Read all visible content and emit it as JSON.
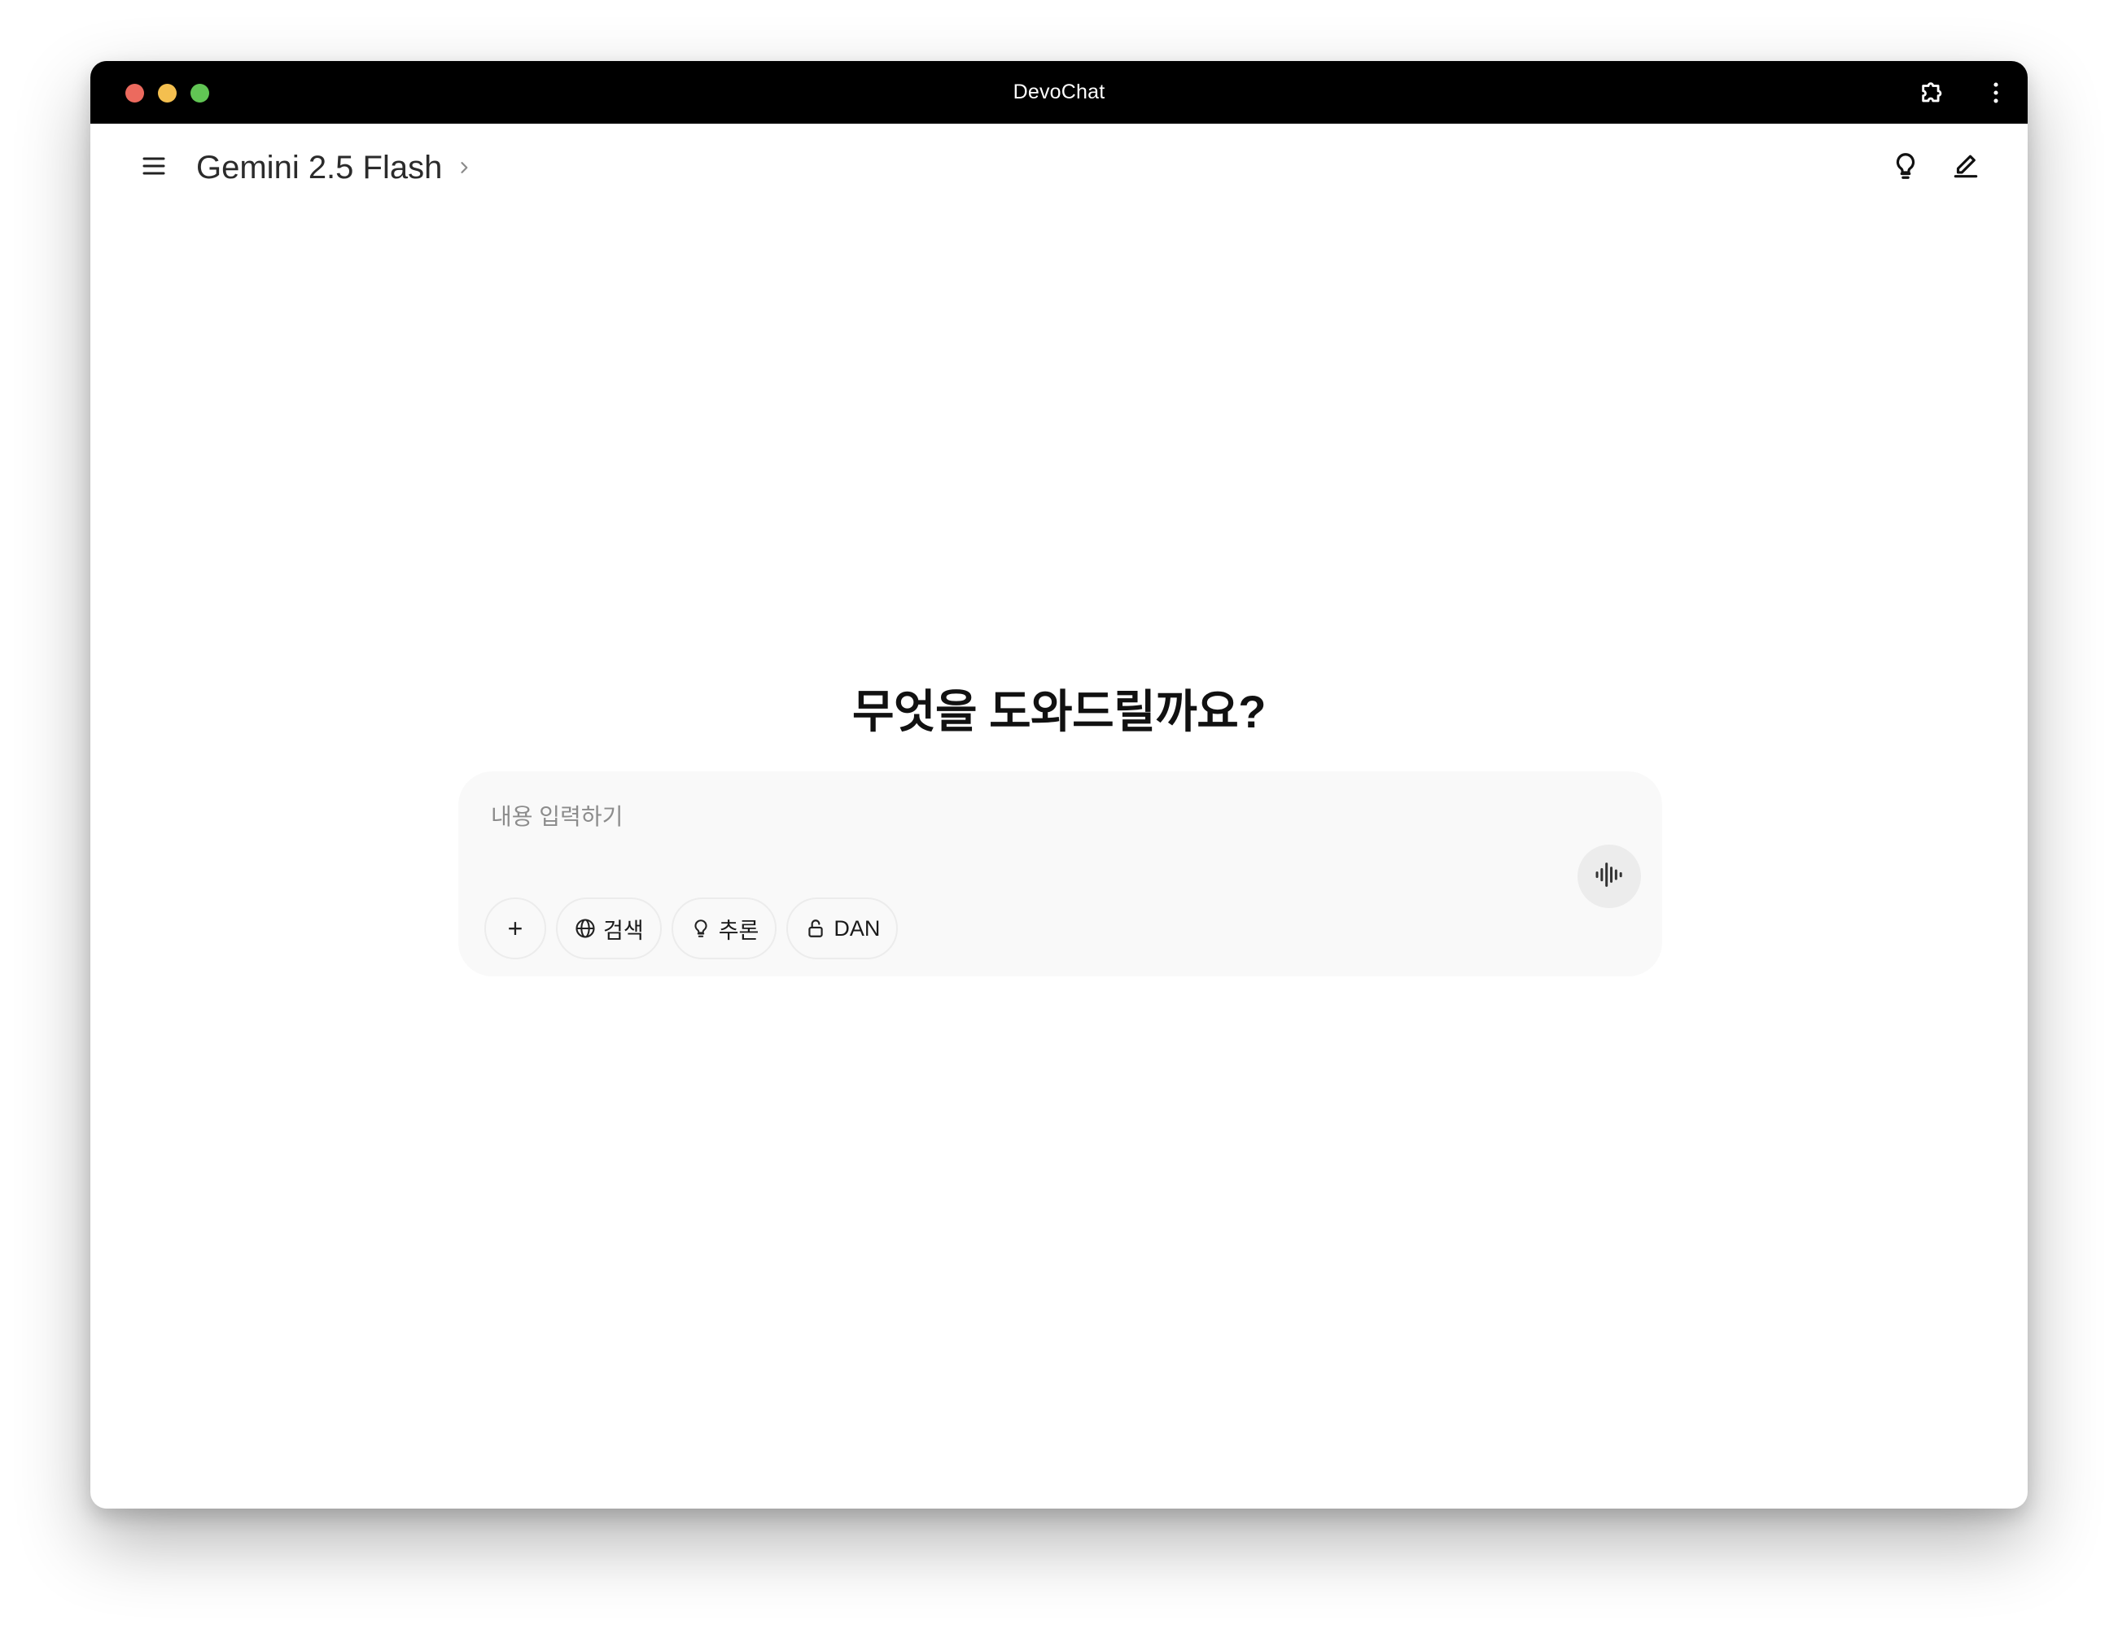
{
  "window": {
    "title": "DevoChat"
  },
  "titlebar_icons": {
    "extension": "puzzle-icon",
    "more": "more-vertical-icon"
  },
  "header": {
    "menu_icon": "hamburger-icon",
    "model_name": "Gemini 2.5 Flash",
    "model_chevron_icon": "chevron-right-icon",
    "actions": [
      "lightbulb-icon",
      "edit-pencil-icon"
    ]
  },
  "main": {
    "greeting": "무엇을 도와드릴까요?"
  },
  "composer": {
    "placeholder": "내용 입력하기",
    "value": "",
    "add_label": "+",
    "chips": {
      "search": "검색",
      "reasoning": "추론",
      "dan": "DAN"
    },
    "voice_icon": "audio-waveform-icon"
  }
}
